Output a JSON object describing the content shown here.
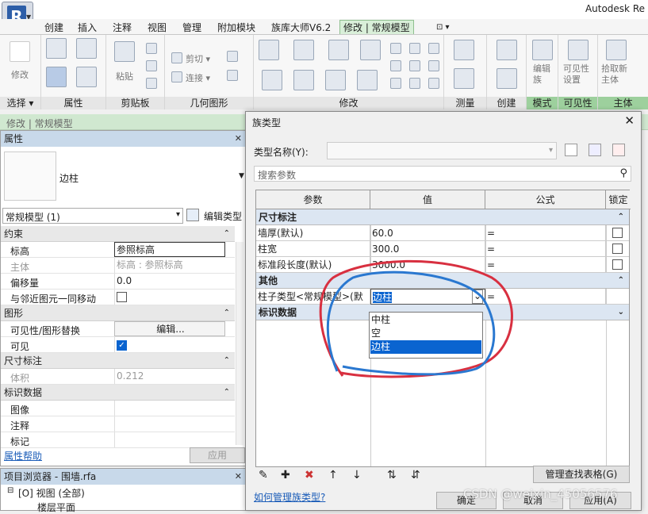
{
  "app": {
    "title": "Autodesk Re",
    "logo": "R"
  },
  "tabs": [
    "创建",
    "插入",
    "注释",
    "视图",
    "管理",
    "附加模块",
    "族库大师V6.2",
    "修改 | 常规模型",
    "⊡ ▾"
  ],
  "ribbon": {
    "panels": [
      "选择 ▾",
      "属性",
      "剪贴板",
      "几何图形",
      "修改",
      "测量",
      "创建",
      "模式",
      "可见性",
      "主体"
    ],
    "texts": [
      "修改",
      "粘贴",
      "剪切 ▾",
      "连接 ▾",
      "编辑族",
      "可见性设置",
      "拾取新主体"
    ]
  },
  "context_bar": "修改 | 常规模型",
  "properties": {
    "title": "属性",
    "type_name": "边柱",
    "type_selector": "常规模型 (1)",
    "edit_type": "编辑类型",
    "rows": [
      {
        "kind": "cat",
        "label": "约束"
      },
      {
        "kind": "row",
        "key": "标高",
        "value": "参照标高"
      },
      {
        "kind": "row",
        "key": "主体",
        "value": "标高 : 参照标高",
        "grey": true
      },
      {
        "kind": "row",
        "key": "偏移量",
        "value": "0.0"
      },
      {
        "kind": "row",
        "key": "与邻近图元一同移动",
        "value": "",
        "check": false
      },
      {
        "kind": "cat",
        "label": "图形"
      },
      {
        "kind": "row",
        "key": "可见性/图形替换",
        "value": "编辑...",
        "button": true
      },
      {
        "kind": "row",
        "key": "可见",
        "value": "",
        "check": true
      },
      {
        "kind": "cat",
        "label": "尺寸标注"
      },
      {
        "kind": "row",
        "key": "体积",
        "value": "0.212",
        "grey": true
      },
      {
        "kind": "cat",
        "label": "标识数据"
      },
      {
        "kind": "row",
        "key": "图像",
        "value": ""
      },
      {
        "kind": "row",
        "key": "注释",
        "value": ""
      },
      {
        "kind": "row",
        "key": "标记",
        "value": ""
      }
    ],
    "help_link": "属性帮助",
    "apply": "应用"
  },
  "browser": {
    "title": "项目浏览器 - 围墙.rfa",
    "items": [
      "[O] 视图 (全部)",
      "楼层平面"
    ]
  },
  "dialog": {
    "title": "族类型",
    "type_name_label": "类型名称(Y):",
    "type_name_value": "",
    "search_placeholder": "搜索参数",
    "columns": [
      "参数",
      "值",
      "公式",
      "锁定"
    ],
    "groups": [
      {
        "label": "尺寸标注",
        "rows": [
          {
            "param": "墙厚(默认)",
            "value": "60.0",
            "formula": "="
          },
          {
            "param": "柱宽",
            "value": "300.0",
            "formula": "="
          },
          {
            "param": "标准段长度(默认)",
            "value": "3000.0",
            "formula": "="
          }
        ]
      },
      {
        "label": "其他",
        "rows": [
          {
            "param": "柱子类型<常规模型>(默",
            "value": "边柱",
            "formula": "="
          }
        ]
      },
      {
        "label": "标识数据",
        "rows": []
      }
    ],
    "dropdown_options": [
      "中柱",
      "空",
      "边柱"
    ],
    "dropdown_selected": 2,
    "manage_lookup": "管理查找表格(G)",
    "help_link": "如何管理族类型?",
    "ok": "确定",
    "cancel": "取消",
    "apply": "应用(A)"
  },
  "watermark": "CSDN @weixin_45056576",
  "annotation_colors": {
    "red": "#d83040",
    "blue": "#2a78d0"
  }
}
